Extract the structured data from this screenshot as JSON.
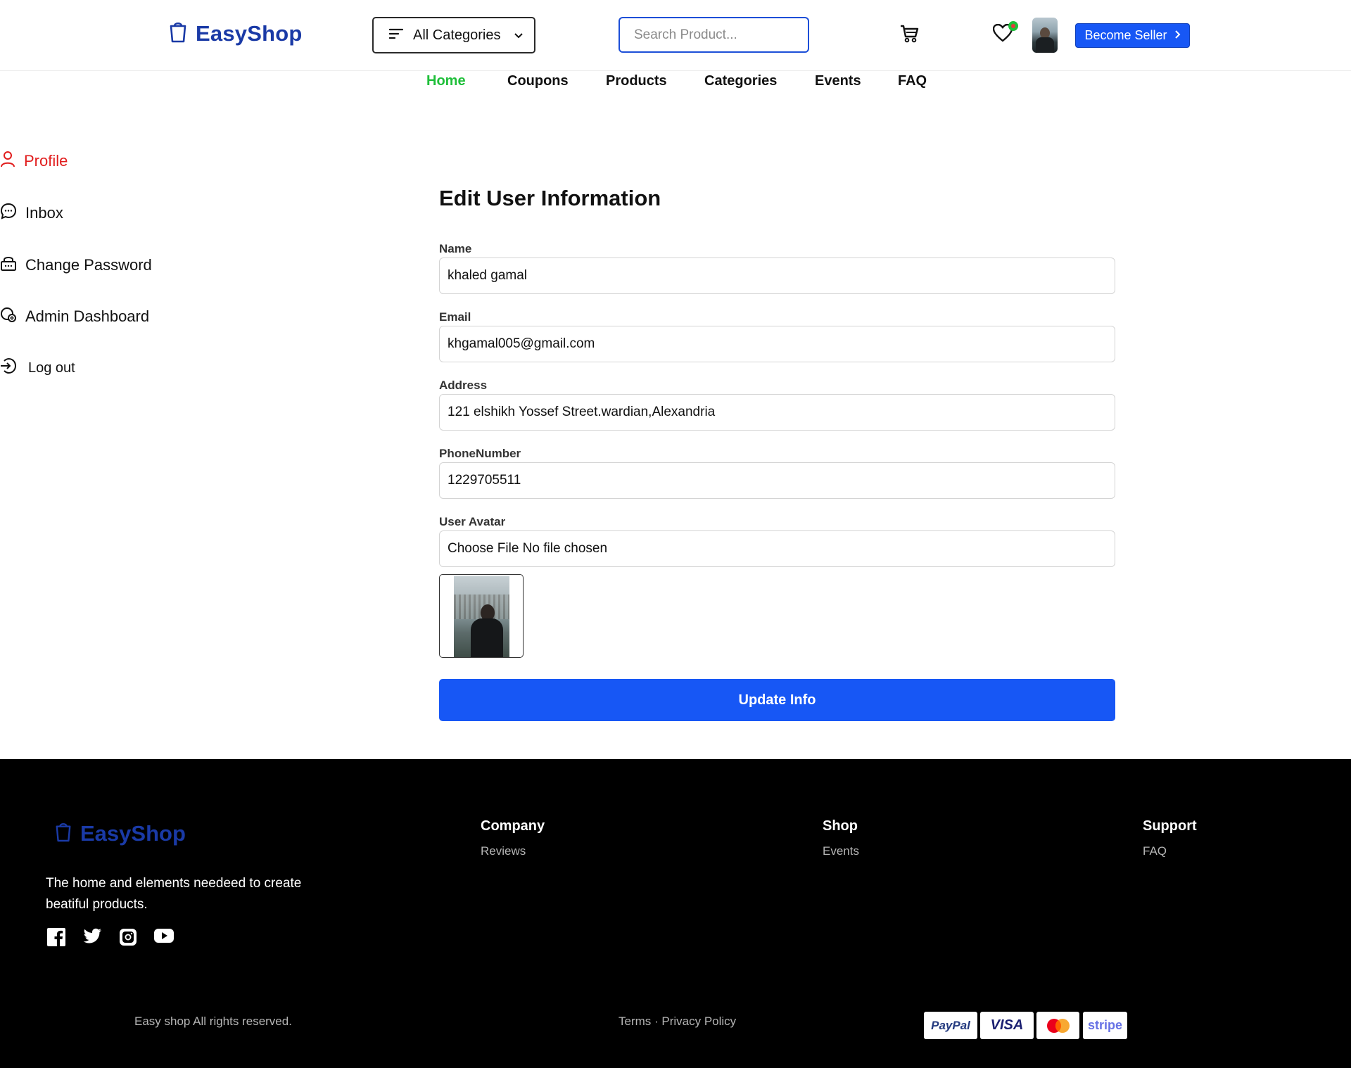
{
  "header": {
    "logo_text": "EasyShop",
    "categories_label": "All Categories",
    "search_placeholder": "Search Product...",
    "become_seller_label": "Become Seller"
  },
  "nav": {
    "items": [
      "Home",
      "Coupons",
      "Products",
      "Categories",
      "Events",
      "FAQ"
    ],
    "active": "Home"
  },
  "sidebar": {
    "items": [
      {
        "label": "Profile",
        "icon": "user-icon",
        "active": true
      },
      {
        "label": "Inbox",
        "icon": "chat-icon"
      },
      {
        "label": "Change Password",
        "icon": "lock-icon"
      },
      {
        "label": "Admin Dashboard",
        "icon": "admin-icon"
      },
      {
        "label": "Log out",
        "icon": "logout-icon"
      }
    ]
  },
  "form": {
    "title": "Edit User Information",
    "fields": [
      {
        "label": "Name",
        "value": "khaled gamal"
      },
      {
        "label": "Email",
        "value": "khgamal005@gmail.com"
      },
      {
        "label": "Address",
        "value": "121 elshikh Yossef Street.wardian,Alexandria"
      },
      {
        "label": "PhoneNumber",
        "value": "1229705511"
      },
      {
        "label": "User Avatar",
        "value": "Choose File No file chosen"
      }
    ],
    "submit_label": "Update Info"
  },
  "footer": {
    "logo_text": "EasyShop",
    "description": "The home and elements needeed to create beatiful products.",
    "social_icons": [
      "facebook-icon",
      "twitter-icon",
      "instagram-icon",
      "youtube-icon"
    ],
    "columns": [
      {
        "title": "Company",
        "links": [
          "Reviews"
        ]
      },
      {
        "title": "Shop",
        "links": [
          "Events"
        ]
      },
      {
        "title": "Support",
        "links": [
          "FAQ"
        ]
      }
    ],
    "copyright": "Easy shop All rights reserved.",
    "legal": "Terms · Privacy Policy",
    "payments": [
      "PayPal",
      "VISA",
      "Mastercard",
      "stripe"
    ]
  },
  "colors": {
    "brand": "#1a3aa6",
    "primary_button": "#1757f5",
    "nav_active": "#1fbf3a",
    "sidebar_active": "#e11d1d",
    "footer_bg": "#000000"
  }
}
